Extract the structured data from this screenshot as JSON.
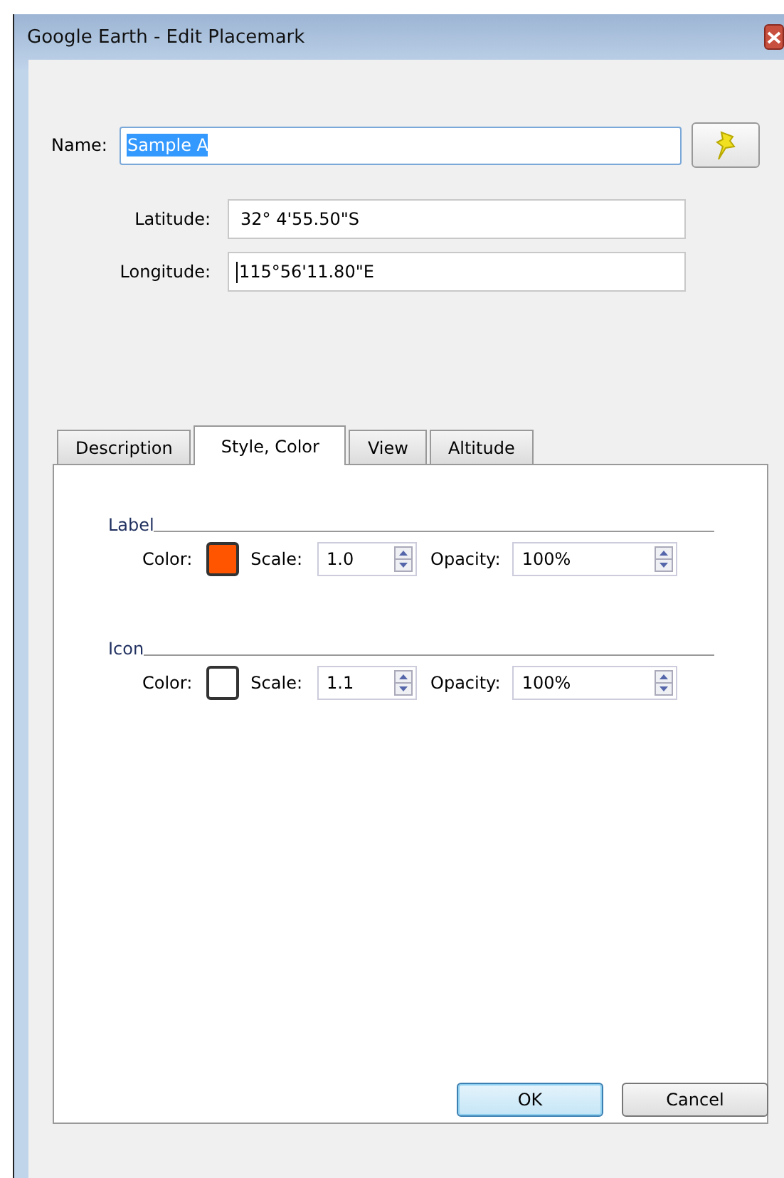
{
  "window": {
    "title": "Google Earth - Edit Placemark"
  },
  "name_field": {
    "label": "Name:",
    "value": "Sample A",
    "highlighted": true
  },
  "coordinates": [
    {
      "label": "Latitude:",
      "value": "32° 4'55.50\"S"
    },
    {
      "label": "Longitude:",
      "value": "115°56'11.80\"E"
    }
  ],
  "tabs": [
    {
      "label": "Description",
      "selected": false
    },
    {
      "label": "Style, Color",
      "selected": true
    },
    {
      "label": "View",
      "selected": false
    },
    {
      "label": "Altitude",
      "selected": false
    }
  ],
  "groups": [
    {
      "title": "Label",
      "color_label": "Color:",
      "color": "#ff5500",
      "scale_label": "Scale:",
      "scale": "1.0",
      "opacity_label": "Opacity:",
      "opacity": "100%"
    },
    {
      "title": "Icon",
      "color_label": "Color:",
      "color": "#ffffff",
      "scale_label": "Scale:",
      "scale": "1.1",
      "opacity_label": "Opacity:",
      "opacity": "100%"
    }
  ],
  "buttons": [
    {
      "label": "OK",
      "default": true
    },
    {
      "label": "Cancel",
      "default": false
    }
  ]
}
